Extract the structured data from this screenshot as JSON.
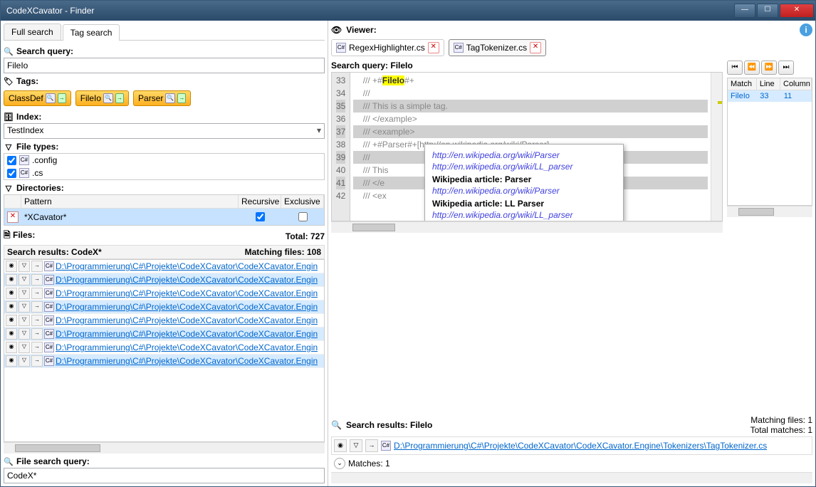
{
  "window": {
    "title": "CodeXCavator - Finder"
  },
  "tabs": {
    "full_search": "Full search",
    "tag_search": "Tag search"
  },
  "search": {
    "query_label": "Search query:",
    "query_value": "FileIo",
    "tags_label": "Tags:",
    "tag_buttons": [
      "ClassDef",
      "FileIo",
      "Parser"
    ]
  },
  "index": {
    "label": "Index:",
    "value": "TestIndex"
  },
  "filetypes": {
    "label": "File types:",
    "items": [
      {
        "checked": true,
        "ext": ".config"
      },
      {
        "checked": true,
        "ext": ".cs"
      }
    ]
  },
  "directories": {
    "label": "Directories:",
    "head": {
      "pattern": "Pattern",
      "recursive": "Recursive",
      "exclusive": "Exclusive"
    },
    "rows": [
      {
        "pattern": "*XCavator*",
        "recursive": true,
        "exclusive": false
      }
    ]
  },
  "files": {
    "label": "Files:",
    "total_label": "Total: 727",
    "results_label": "Search results: CodeX*",
    "matching_label": "Matching files: 108",
    "items": [
      {
        "hl": false,
        "path": "D:\\Programmierung\\C#\\Projekte\\CodeXCavator\\CodeXCavator.Engin"
      },
      {
        "hl": true,
        "path": "D:\\Programmierung\\C#\\Projekte\\CodeXCavator\\CodeXCavator.Engin"
      },
      {
        "hl": false,
        "path": "D:\\Programmierung\\C#\\Projekte\\CodeXCavator\\CodeXCavator.Engin"
      },
      {
        "hl": true,
        "path": "D:\\Programmierung\\C#\\Projekte\\CodeXCavator\\CodeXCavator.Engin"
      },
      {
        "hl": false,
        "path": "D:\\Programmierung\\C#\\Projekte\\CodeXCavator\\CodeXCavator.Engin"
      },
      {
        "hl": true,
        "path": "D:\\Programmierung\\C#\\Projekte\\CodeXCavator\\CodeXCavator.Engin"
      },
      {
        "hl": false,
        "path": "D:\\Programmierung\\C#\\Projekte\\CodeXCavator\\CodeXCavator.Engin"
      },
      {
        "hl": true,
        "path": "D:\\Programmierung\\C#\\Projekte\\CodeXCavator\\CodeXCavator.Engin"
      }
    ]
  },
  "file_search": {
    "label": "File search query:",
    "value": "CodeX*"
  },
  "viewer": {
    "label": "Viewer:",
    "file_tabs": [
      {
        "name": "RegexHighlighter.cs",
        "active": false
      },
      {
        "name": "TagTokenizer.cs",
        "active": true
      }
    ],
    "search_query": "Search query: FileIo",
    "lines": [
      {
        "n": 33,
        "pre": "/// +#",
        "hl": "FileIo",
        "post": "#+",
        "hlrow": false
      },
      {
        "n": 34,
        "pre": "///",
        "hl": "",
        "post": "",
        "hlrow": false
      },
      {
        "n": 35,
        "pre": "/// This is a simple tag.",
        "hl": "",
        "post": "",
        "hlrow": true
      },
      {
        "n": 36,
        "pre": "/// </example>",
        "hl": "",
        "post": "",
        "hlrow": false
      },
      {
        "n": 37,
        "pre": "/// <example>",
        "hl": "",
        "post": "",
        "hlrow": true
      },
      {
        "n": 38,
        "pre": "/// +#Parser#+[http://en.wikipedia.org/wiki/Parser]",
        "hl": "",
        "post": "",
        "hlrow": false
      },
      {
        "n": 39,
        "pre": "///",
        "hl": "",
        "post": "",
        "hlrow": true
      },
      {
        "n": 40,
        "pre": "/// This",
        "hl": "",
        "post": "",
        "hlrow": false
      },
      {
        "n": 41,
        "pre": "/// </e",
        "hl": "",
        "post": "",
        "hlrow": true
      },
      {
        "n": 42,
        "pre": "/// <ex",
        "hl": "",
        "post": "",
        "hlrow": false
      }
    ],
    "popup": {
      "link1": "http://en.wikipedia.org/wiki/Parser",
      "link2": "http://en.wikipedia.org/wiki/LL_parser",
      "title1": "Wikipedia article: Parser",
      "link3": "http://en.wikipedia.org/wiki/Parser",
      "title2": "Wikipedia article: LL Parser",
      "link4": "http://en.wikipedia.org/wiki/LL_parser"
    }
  },
  "match_table": {
    "head": {
      "match": "Match",
      "line": "Line",
      "column": "Column"
    },
    "rows": [
      {
        "match": "FileIo",
        "line": "33",
        "column": "11"
      }
    ]
  },
  "search_results": {
    "label": "Search results: FileIo",
    "matching_files": "Matching files: 1",
    "total_matches": "Total matches: 1",
    "file_path": "D:\\Programmierung\\C#\\Projekte\\CodeXCavator\\CodeXCavator.Engine\\Tokenizers\\TagTokenizer.cs",
    "matches_label": "Matches: 1"
  }
}
